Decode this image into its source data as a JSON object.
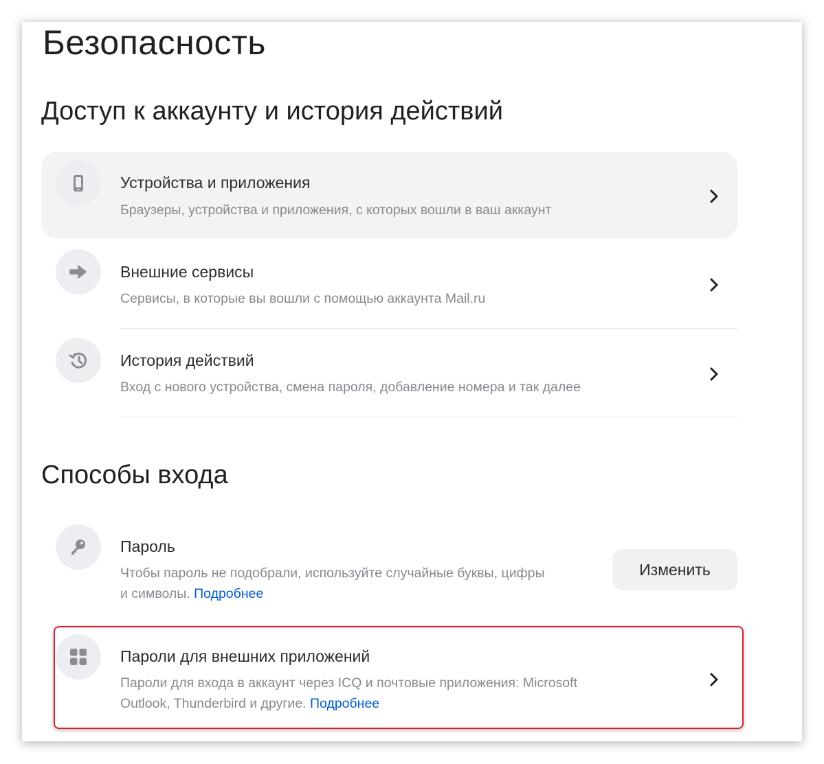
{
  "page": {
    "title": "Безопасность"
  },
  "access": {
    "title": "Доступ к аккаунту и история действий",
    "items": [
      {
        "title": "Устройства и приложения",
        "subtitle": "Браузеры, устройства и приложения, с которых вошли в ваш аккаунт",
        "icon": "phone-icon"
      },
      {
        "title": "Внешние сервисы",
        "subtitle": "Сервисы, в которые вы вошли с помощью аккаунта Mail.ru",
        "icon": "arrow-right-icon"
      },
      {
        "title": "История действий",
        "subtitle": "Вход с нового устройства, смена пароля, добавление номера и так далее",
        "icon": "history-icon"
      }
    ]
  },
  "login": {
    "title": "Способы входа",
    "password": {
      "title": "Пароль",
      "subtitle_line1": "Чтобы пароль не подобрали, используйте случайные буквы, цифры",
      "subtitle_line2": "и символы.",
      "link": "Подробнее",
      "button": "Изменить",
      "icon": "key-icon"
    },
    "app_passwords": {
      "title": "Пароли для внешних приложений",
      "subtitle_line1": "Пароли для входа в аккаунт через ICQ и почтовые приложения: Microsoft",
      "subtitle_line2": "Outlook, Thunderbird и другие.",
      "link": "Подробнее",
      "icon": "grid-icon"
    }
  },
  "colors": {
    "link": "#005bd1",
    "highlight": "#d7232e",
    "icon_bg": "#eceef1",
    "muted": "#87898f"
  }
}
